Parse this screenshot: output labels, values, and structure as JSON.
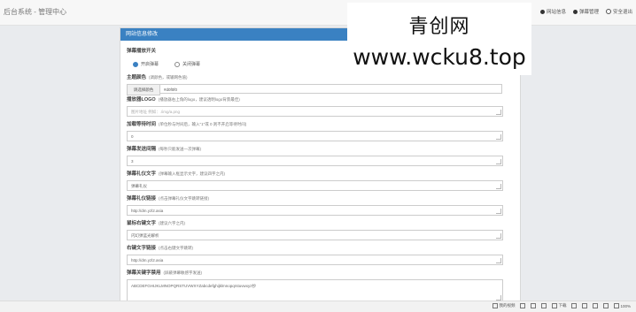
{
  "header": {
    "title": "后台系统 - 管理中心",
    "nav": [
      {
        "label": "网站信息",
        "icon": "settings-icon"
      },
      {
        "label": "弹幕管理",
        "icon": "info-icon"
      },
      {
        "label": "安全退出",
        "icon": "power-icon"
      }
    ]
  },
  "watermark": {
    "text_cn": "青创网",
    "url": "www.wcku8.top"
  },
  "panel": {
    "title": "网站信息修改",
    "switch": {
      "label": "弹幕播放开关",
      "options": [
        "开启弹幕",
        "关闭弹幕"
      ],
      "selected": "开启弹幕"
    },
    "theme_color": {
      "label": "主题颜色",
      "hint": "(调颜色，或输网色值)",
      "button_label": "请选择颜色",
      "value": "#d0f0f0"
    },
    "logo": {
      "label": "播放器LOGO",
      "hint": "(播放器右上角的logo，建议透明logo背景最佳)",
      "placeholder": "图片地址 例如：./img/a.png"
    },
    "retry_time": {
      "label": "加载等待时间",
      "hint": "(单位秒与时间后，输入\"1\"或 0 则不开启等待时间)",
      "value": "0"
    },
    "send_interval": {
      "label": "弹幕发送间隔",
      "hint": "(每秒只能发送一次弹幕)",
      "value": "3"
    },
    "gift_text": {
      "label": "弹幕礼仪文字",
      "hint": "(弹幕输入框显示文字，建议四字之内)",
      "value": "弹幕礼仪"
    },
    "gift_link": {
      "label": "弹幕礼仪链接",
      "hint": "(点击弹幕礼仪文字跳转链接)",
      "value": "http://dm.yzl2.asia"
    },
    "right_menu_text": {
      "label": "鼠标右键文字",
      "hint": "(建议六字之内)",
      "value": "闪幻弹蓝光解析"
    },
    "right_menu_link": {
      "label": "右键文字链接",
      "hint": "(点击右键文字跳转)",
      "value": "http://dm.yzl2.asia"
    },
    "blocked_words": {
      "label": "弹幕关键字禁用",
      "hint": "(屏蔽弹幕敏感字发送)",
      "value": "ABCDEFGHIJKLMNOPQRSTUVWXYZabcdefghijklmnopqrstuvwxyz抄"
    }
  },
  "statusbar": {
    "items": [
      {
        "label": "我的视频",
        "icon": "video-icon"
      },
      {
        "label": "",
        "icon": "square-icon"
      },
      {
        "label": "",
        "icon": "screen-icon"
      },
      {
        "label": "",
        "icon": "grid-icon"
      },
      {
        "label": "下载",
        "icon": "download-icon"
      },
      {
        "label": "",
        "icon": "box-icon"
      },
      {
        "label": "",
        "icon": "window-icon"
      },
      {
        "label": "",
        "icon": "sound-icon"
      },
      {
        "label": "",
        "icon": "speaker-icon"
      },
      {
        "label": "100%",
        "icon": "zoom-icon"
      }
    ]
  },
  "colors": {
    "panel_header": "#3a81c2",
    "background": "#e9ebee"
  }
}
